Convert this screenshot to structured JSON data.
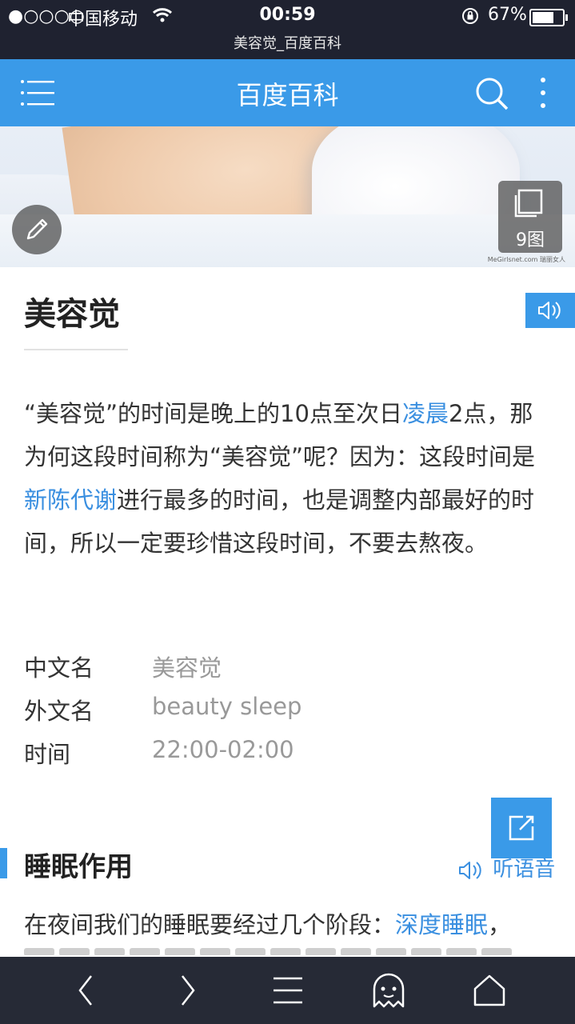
{
  "status_bar": {
    "signal": "●○○○○",
    "carrier": "中国移动",
    "time": "00:59",
    "url_title": "美容觉_百度百科",
    "battery": "67%"
  },
  "header": {
    "title": "百度百科",
    "icons": [
      "menu-icon",
      "search-icon",
      "more-vertical-icon"
    ]
  },
  "hero": {
    "watermark": "MeGirlsnet.com 瑞丽女人",
    "image_count": "9图"
  },
  "article": {
    "title": "美容觉",
    "summary": {
      "p1": "“美容觉”的时间是晚上的10点至次日",
      "link1": "凌晨",
      "p2": "2点，那为何这段时间称为“美容觉”呢？因为：这段时间是",
      "link2": "新陈代谢",
      "p3": "进行最多的时间，也是调整内部最好的时间，所以一定要珍惜这段时间，不要去熬夜。"
    },
    "info": [
      {
        "key": "中文名",
        "value": "美容觉"
      },
      {
        "key": "外文名",
        "value": "beauty sleep"
      },
      {
        "key": "时间",
        "value": "22:00-02:00"
      }
    ]
  },
  "section": {
    "title": "睡眠作用",
    "listen_label": "听语音",
    "text_prefix": "在夜间我们的睡眠要经过几个阶段：",
    "text_link": "深度睡眠",
    "text_suffix": "，"
  },
  "colors": {
    "accent": "#3a9ae8",
    "link": "#3a8fe0",
    "status_bg": "#1f2230",
    "toolbar_bg": "#262a36"
  }
}
